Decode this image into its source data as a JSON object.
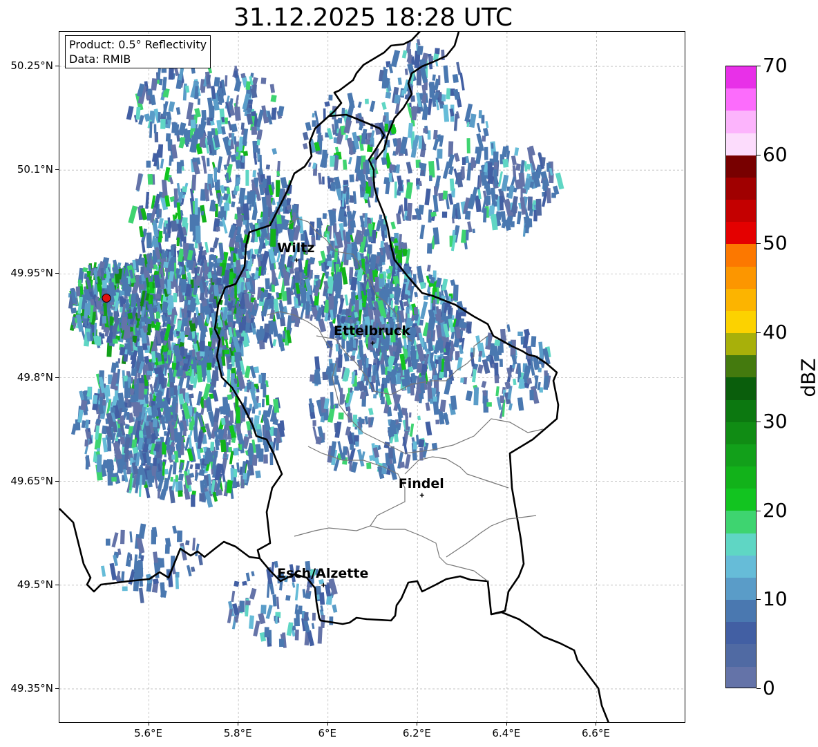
{
  "title": "31.12.2025 18:28 UTC",
  "info_box": {
    "product": "Product: 0.5° Reflectivity",
    "source": "Data: RMIB"
  },
  "map": {
    "lon_range": [
      5.4,
      6.8
    ],
    "lat_range": [
      49.3,
      50.3
    ],
    "x_ticks": [
      "5.6°E",
      "5.8°E",
      "6°E",
      "6.2°E",
      "6.4°E",
      "6.6°E"
    ],
    "y_ticks": [
      "50.25°N",
      "50.1°N",
      "49.95°N",
      "49.8°N",
      "49.65°N",
      "49.5°N",
      "49.35°N"
    ],
    "grid": true,
    "radar_site": {
      "lon": 5.505,
      "lat": 49.915
    },
    "cities": [
      {
        "name": "Wiltz",
        "lon": 5.93,
        "lat": 49.97
      },
      {
        "name": "Ettelbruck",
        "lon": 6.1,
        "lat": 49.85
      },
      {
        "name": "Findel",
        "lon": 6.21,
        "lat": 49.63
      },
      {
        "name": "Esch/Alzette",
        "lon": 5.99,
        "lat": 49.5
      }
    ]
  },
  "colorbar": {
    "label": "dBZ",
    "ticks": [
      "0",
      "10",
      "20",
      "30",
      "40",
      "50",
      "60",
      "70"
    ],
    "range": [
      0,
      70
    ],
    "colors": [
      "#6473a8",
      "#506aa3",
      "#425fa3",
      "#4a78b0",
      "#5a9cc8",
      "#66bcd8",
      "#5fd6c4",
      "#3ed470",
      "#12c420",
      "#12b21a",
      "#12a01a",
      "#108c14",
      "#0c7810",
      "#0a5e0c",
      "#447a0e",
      "#a8b00a",
      "#fcd200",
      "#fcb400",
      "#fc9600",
      "#fc7800",
      "#e40000",
      "#c40000",
      "#a00000",
      "#780000",
      "#fcdcfc",
      "#fcb4fc",
      "#fc6cfc",
      "#e830e8"
    ]
  }
}
